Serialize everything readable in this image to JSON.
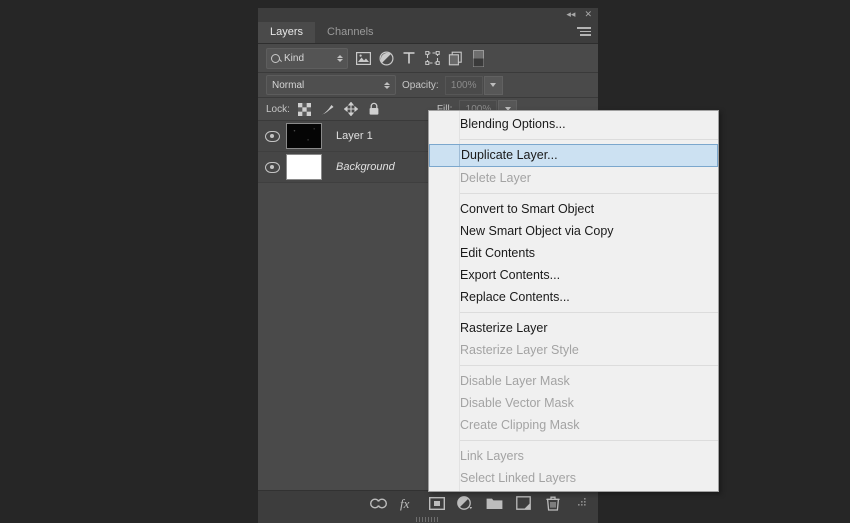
{
  "window": {
    "background_color": "#262626"
  },
  "panel": {
    "titlebar": {
      "collapse_label": "◂◂",
      "close_label": "✕"
    },
    "tabs": [
      {
        "label": "Layers",
        "active": true
      },
      {
        "label": "Channels",
        "active": false
      }
    ],
    "menu_button_name": "panel-menu",
    "filter": {
      "kind_label": "Kind",
      "icons": [
        "pixel-layer-filter-icon",
        "adjustment-layer-filter-icon",
        "type-layer-filter-icon",
        "shape-layer-filter-icon",
        "smart-object-filter-icon",
        "filter-toggle-icon"
      ]
    },
    "blend": {
      "mode": "Normal",
      "opacity_label": "Opacity:",
      "opacity_value": "100%"
    },
    "lock": {
      "label": "Lock:",
      "icons": [
        "lock-transparency-icon",
        "lock-image-icon",
        "lock-position-icon",
        "lock-all-icon"
      ],
      "fill_label": "Fill:",
      "fill_value": "100%"
    },
    "layers": [
      {
        "name": "Layer 1",
        "italic": false,
        "thumb": "dark",
        "visible": true
      },
      {
        "name": "Background",
        "italic": true,
        "thumb": "white",
        "visible": true
      }
    ],
    "bottom_icons": [
      "link-layers-icon",
      "layer-style-fx-icon",
      "add-layer-mask-icon",
      "new-adjustment-layer-icon",
      "new-group-icon",
      "new-layer-icon",
      "delete-layer-icon"
    ]
  },
  "context_menu": {
    "highlight_color": "#cce1f2",
    "items": [
      {
        "label": "Blending Options...",
        "state": "normal"
      },
      {
        "type": "separator"
      },
      {
        "label": "Duplicate Layer...",
        "state": "selected"
      },
      {
        "label": "Delete Layer",
        "state": "disabled"
      },
      {
        "type": "separator"
      },
      {
        "label": "Convert to Smart Object",
        "state": "normal"
      },
      {
        "label": "New Smart Object via Copy",
        "state": "normal"
      },
      {
        "label": "Edit Contents",
        "state": "normal"
      },
      {
        "label": "Export Contents...",
        "state": "normal"
      },
      {
        "label": "Replace Contents...",
        "state": "normal"
      },
      {
        "type": "separator"
      },
      {
        "label": "Rasterize Layer",
        "state": "normal"
      },
      {
        "label": "Rasterize Layer Style",
        "state": "disabled"
      },
      {
        "type": "separator"
      },
      {
        "label": "Disable Layer Mask",
        "state": "disabled"
      },
      {
        "label": "Disable Vector Mask",
        "state": "disabled"
      },
      {
        "label": "Create Clipping Mask",
        "state": "disabled"
      },
      {
        "type": "separator"
      },
      {
        "label": "Link Layers",
        "state": "disabled"
      },
      {
        "label": "Select Linked Layers",
        "state": "disabled"
      }
    ]
  }
}
